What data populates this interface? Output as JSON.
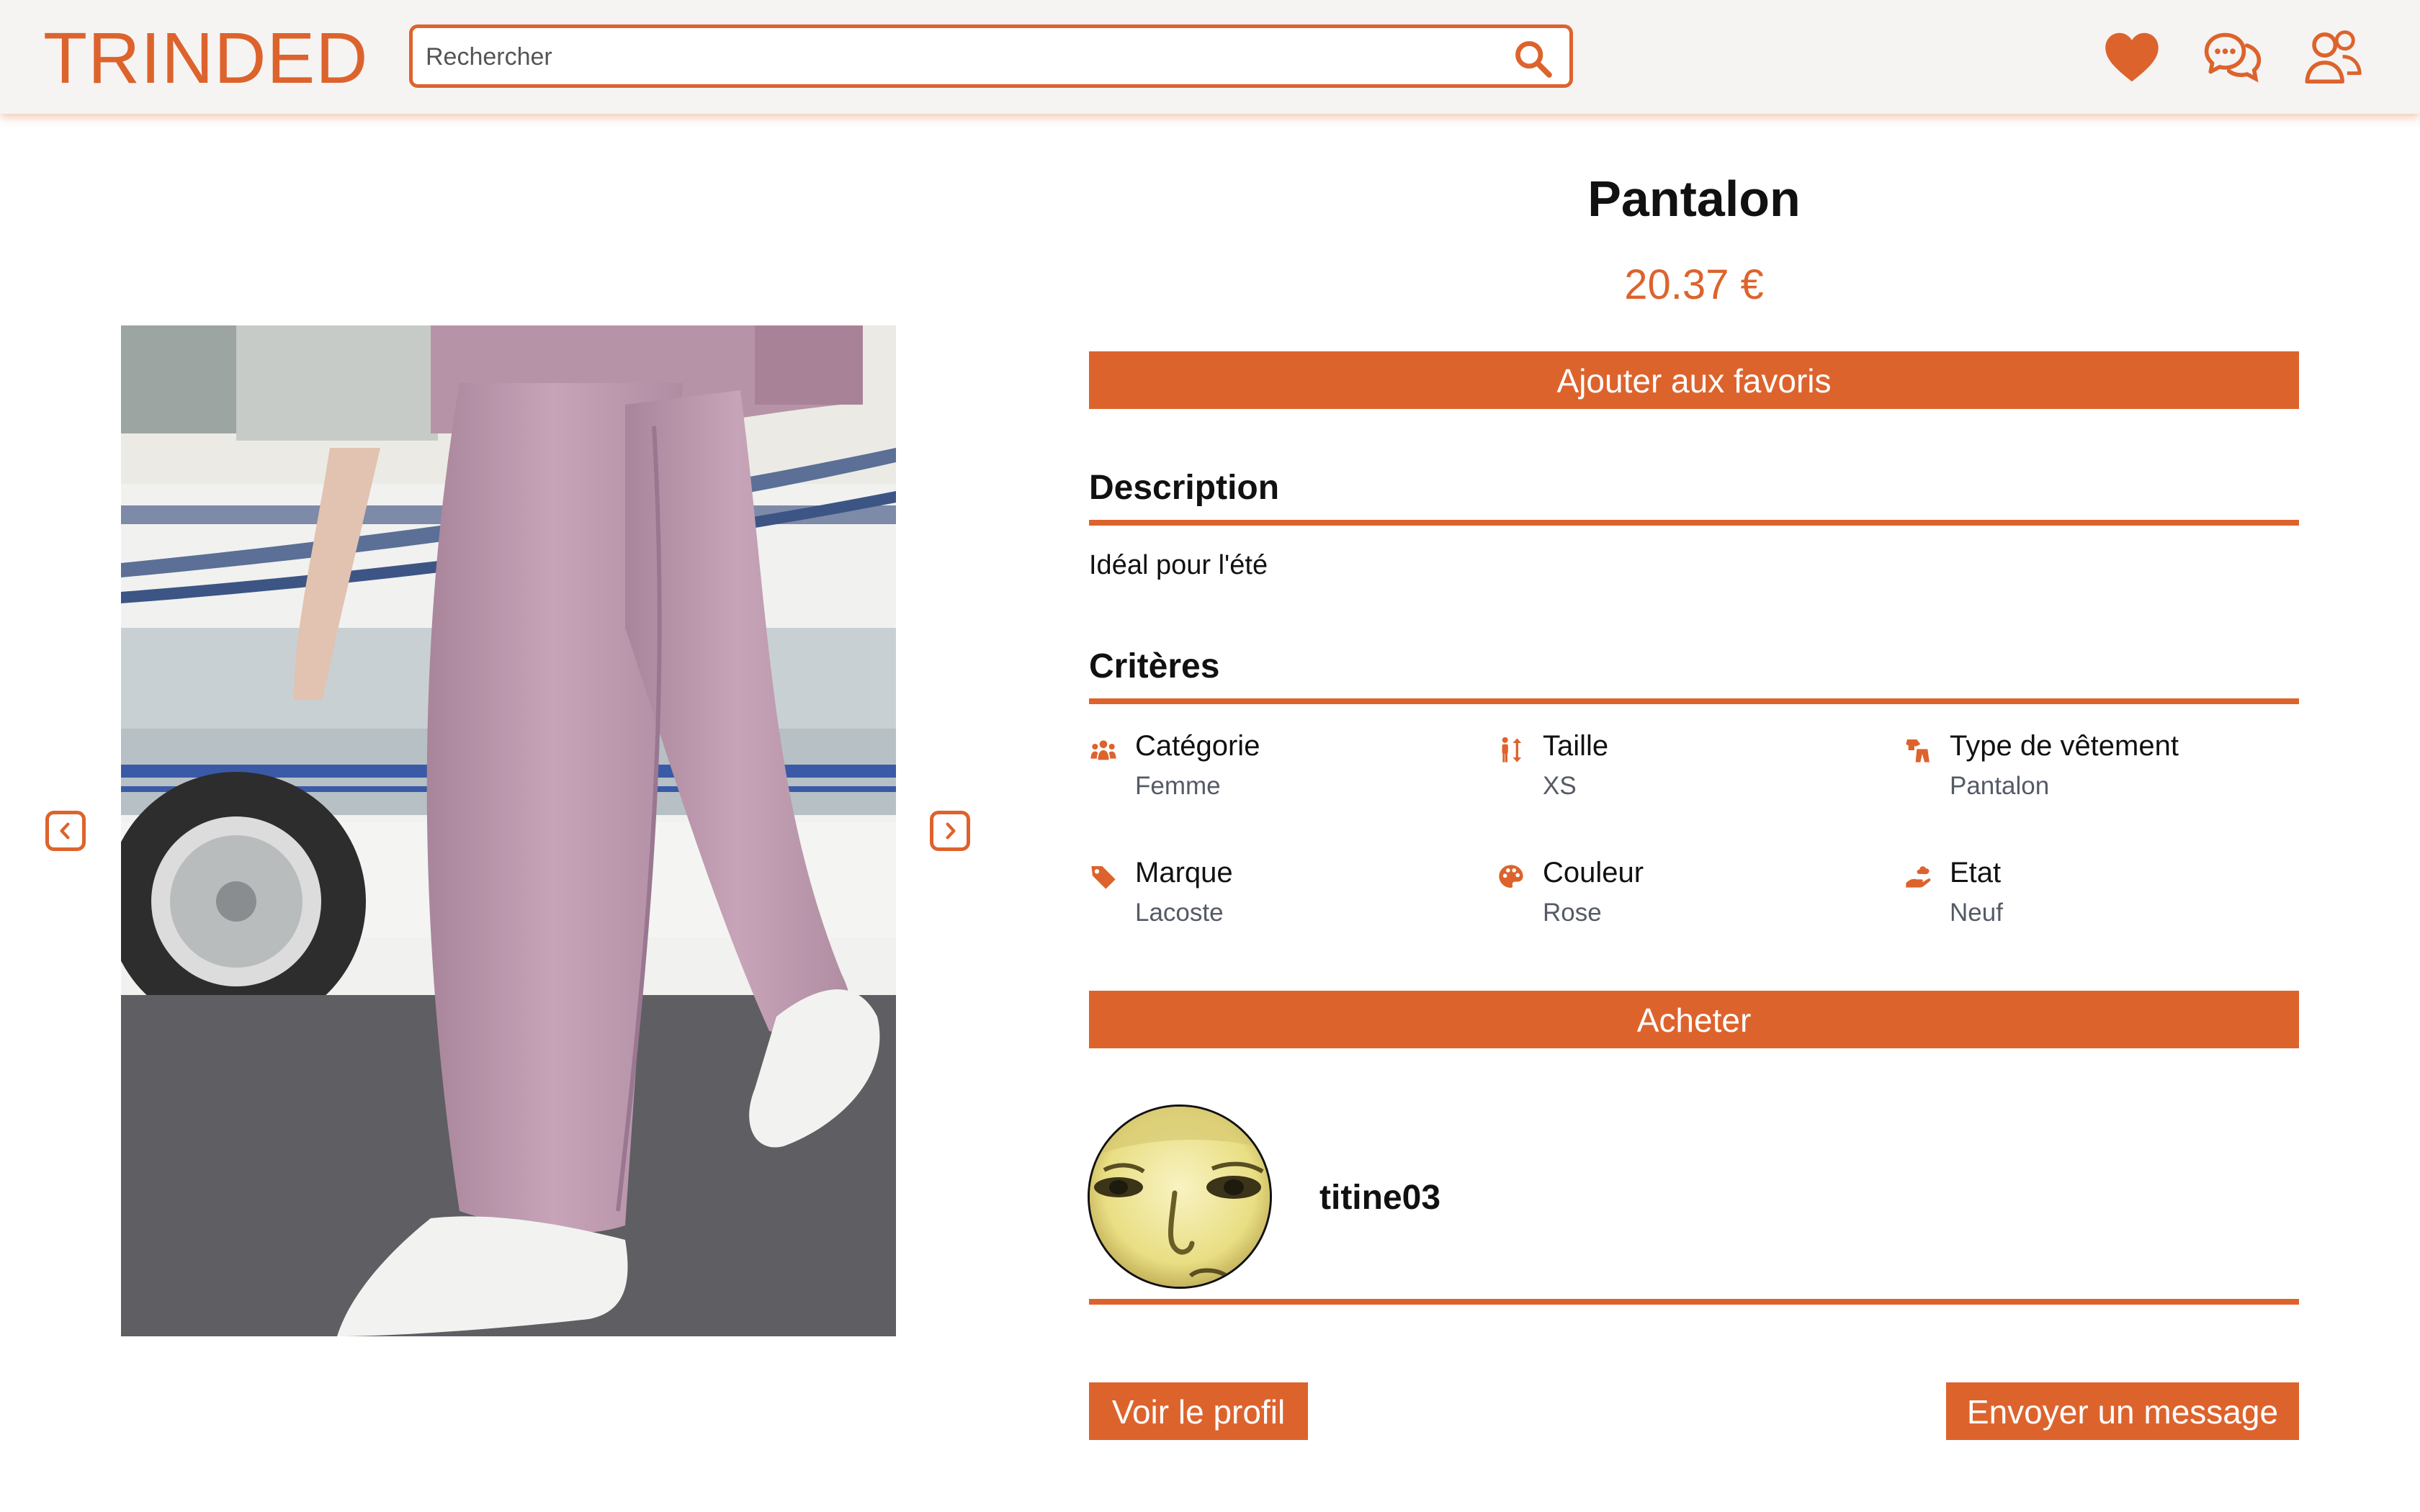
{
  "header": {
    "logo": "TRINDED",
    "search_placeholder": "Rechercher",
    "icons": [
      "search-icon",
      "heart-icon",
      "chat-icon",
      "users-icon"
    ]
  },
  "carousel": {
    "icons": [
      "chevron-left-icon",
      "chevron-right-icon"
    ]
  },
  "product": {
    "title": "Pantalon",
    "price": "20.37 €",
    "favorite_label": "Ajouter aux favoris",
    "description_heading": "Description",
    "description_text": "Idéal pour l'été",
    "criteria_heading": "Critères",
    "criteria": [
      {
        "label": "Catégorie",
        "value": "Femme",
        "icon": "people-icon"
      },
      {
        "label": "Taille",
        "value": "XS",
        "icon": "size-icon"
      },
      {
        "label": "Type de vêtement",
        "value": "Pantalon",
        "icon": "clothing-type-icon"
      },
      {
        "label": "Marque",
        "value": "Lacoste",
        "icon": "tag-icon"
      },
      {
        "label": "Couleur",
        "value": "Rose",
        "icon": "palette-icon"
      },
      {
        "label": "Etat",
        "value": "Neuf",
        "icon": "condition-icon"
      }
    ],
    "buy_label": "Acheter"
  },
  "seller": {
    "username": "titine03",
    "view_profile_label": "Voir le profil",
    "send_message_label": "Envoyer un message"
  },
  "colors": {
    "accent": "#dd632d",
    "header_bg": "#f5f4f2",
    "muted_text": "#555a66"
  }
}
